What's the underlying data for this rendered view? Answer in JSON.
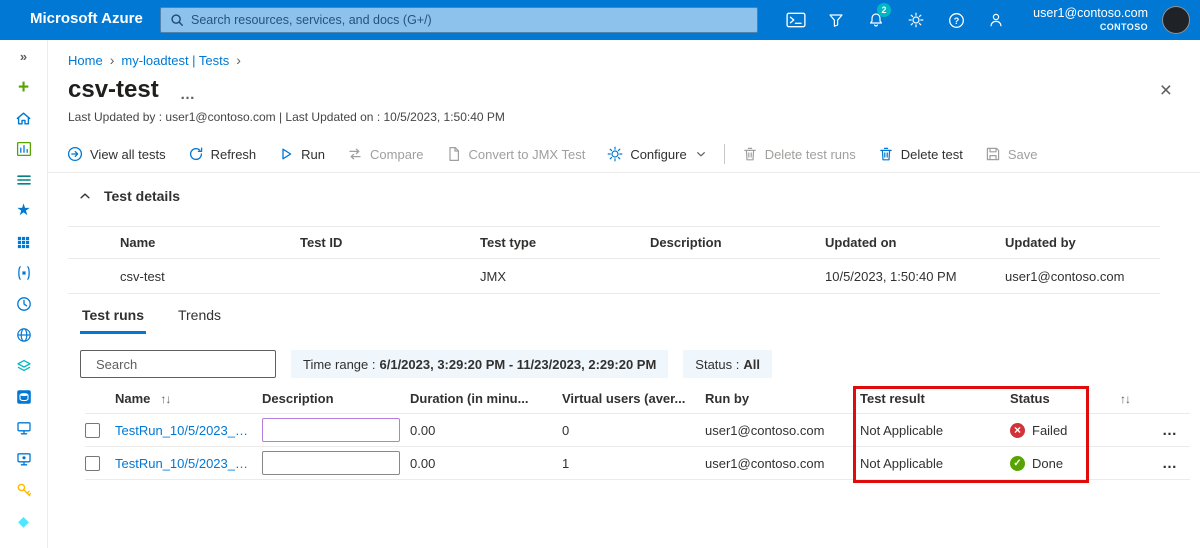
{
  "colors": {
    "topbar_blue": "#0078d4",
    "accent_blue": "#0078d4",
    "annotation_red": "#e00b0b",
    "status_failed_red": "#d13438",
    "status_done_green": "#57a300",
    "focused_input_purple": "#b57edc",
    "pill_background": "#eff6fc"
  },
  "icons": {
    "sidebar_collapse": "»",
    "plus": "+",
    "star": "★",
    "azure_diamond": "◆",
    "breadcrumb_separator": "›",
    "sort": "↑↓",
    "ellipsis": "…",
    "close": "×"
  },
  "topbar": {
    "logo": "Microsoft Azure",
    "search_placeholder": "Search resources, services, and docs (G+/)",
    "notification_count": "2",
    "account_email": "user1@contoso.com",
    "account_tenant": "CONTOSO"
  },
  "sidebar": {
    "items": [
      "collapse",
      "create-resource",
      "home",
      "dashboard",
      "all-services",
      "favorites",
      "all-resources",
      "resource-groups",
      "recent",
      "app-services",
      "storage-accounts",
      "sql-databases",
      "virtual-machines",
      "load-testing",
      "key-vaults",
      "azure-services"
    ]
  },
  "breadcrumb": {
    "home": "Home",
    "current": "my-loadtest | Tests"
  },
  "page": {
    "title": "csv-test",
    "subtitle": "Last Updated by : user1@contoso.com | Last Updated on : 10/5/2023, 1:50:40 PM"
  },
  "command_bar": {
    "items": [
      {
        "label": "View all tests",
        "enabled": true
      },
      {
        "label": "Refresh",
        "enabled": true
      },
      {
        "label": "Run",
        "enabled": true
      },
      {
        "label": "Compare",
        "enabled": false
      },
      {
        "label": "Convert to JMX Test",
        "enabled": false
      },
      {
        "label": "Configure",
        "enabled": true,
        "has_dropdown": true
      },
      {
        "label": "Delete test runs",
        "enabled": false
      },
      {
        "label": "Delete test",
        "enabled": true
      },
      {
        "label": "Save",
        "enabled": false
      }
    ]
  },
  "test_details": {
    "heading": "Test details",
    "columns": [
      "Name",
      "Test ID",
      "Test type",
      "Description",
      "Updated on",
      "Updated by"
    ],
    "row": {
      "name": "csv-test",
      "test_id": "",
      "test_type": "JMX",
      "description": "",
      "updated_on": "10/5/2023, 1:50:40 PM",
      "updated_by": "user1@contoso.com"
    }
  },
  "tabs": {
    "items": [
      {
        "label": "Test runs",
        "active": true
      },
      {
        "label": "Trends",
        "active": false
      }
    ]
  },
  "filters": {
    "search_placeholder": "Search",
    "time_range_label": "Time range :",
    "time_range_value": "6/1/2023, 3:29:20 PM - 11/23/2023, 2:29:20 PM",
    "status_label": "Status :",
    "status_value": "All"
  },
  "runs_table": {
    "columns": {
      "name": "Name",
      "description": "Description",
      "duration": "Duration (in minu...",
      "virtual_users": "Virtual users (aver...",
      "run_by": "Run by",
      "test_result": "Test result",
      "status": "Status"
    },
    "rows": [
      {
        "name": "TestRun_10/5/2023_1:...",
        "description_value": "",
        "duration": "0.00",
        "virtual_users": "0",
        "run_by": "user1@contoso.com",
        "test_result": "Not Applicable",
        "status": "Failed",
        "status_kind": "failed"
      },
      {
        "name": "TestRun_10/5/2023_1:...",
        "description_value": "",
        "duration": "0.00",
        "virtual_users": "1",
        "run_by": "user1@contoso.com",
        "test_result": "Not Applicable",
        "status": "Done",
        "status_kind": "done"
      }
    ]
  }
}
